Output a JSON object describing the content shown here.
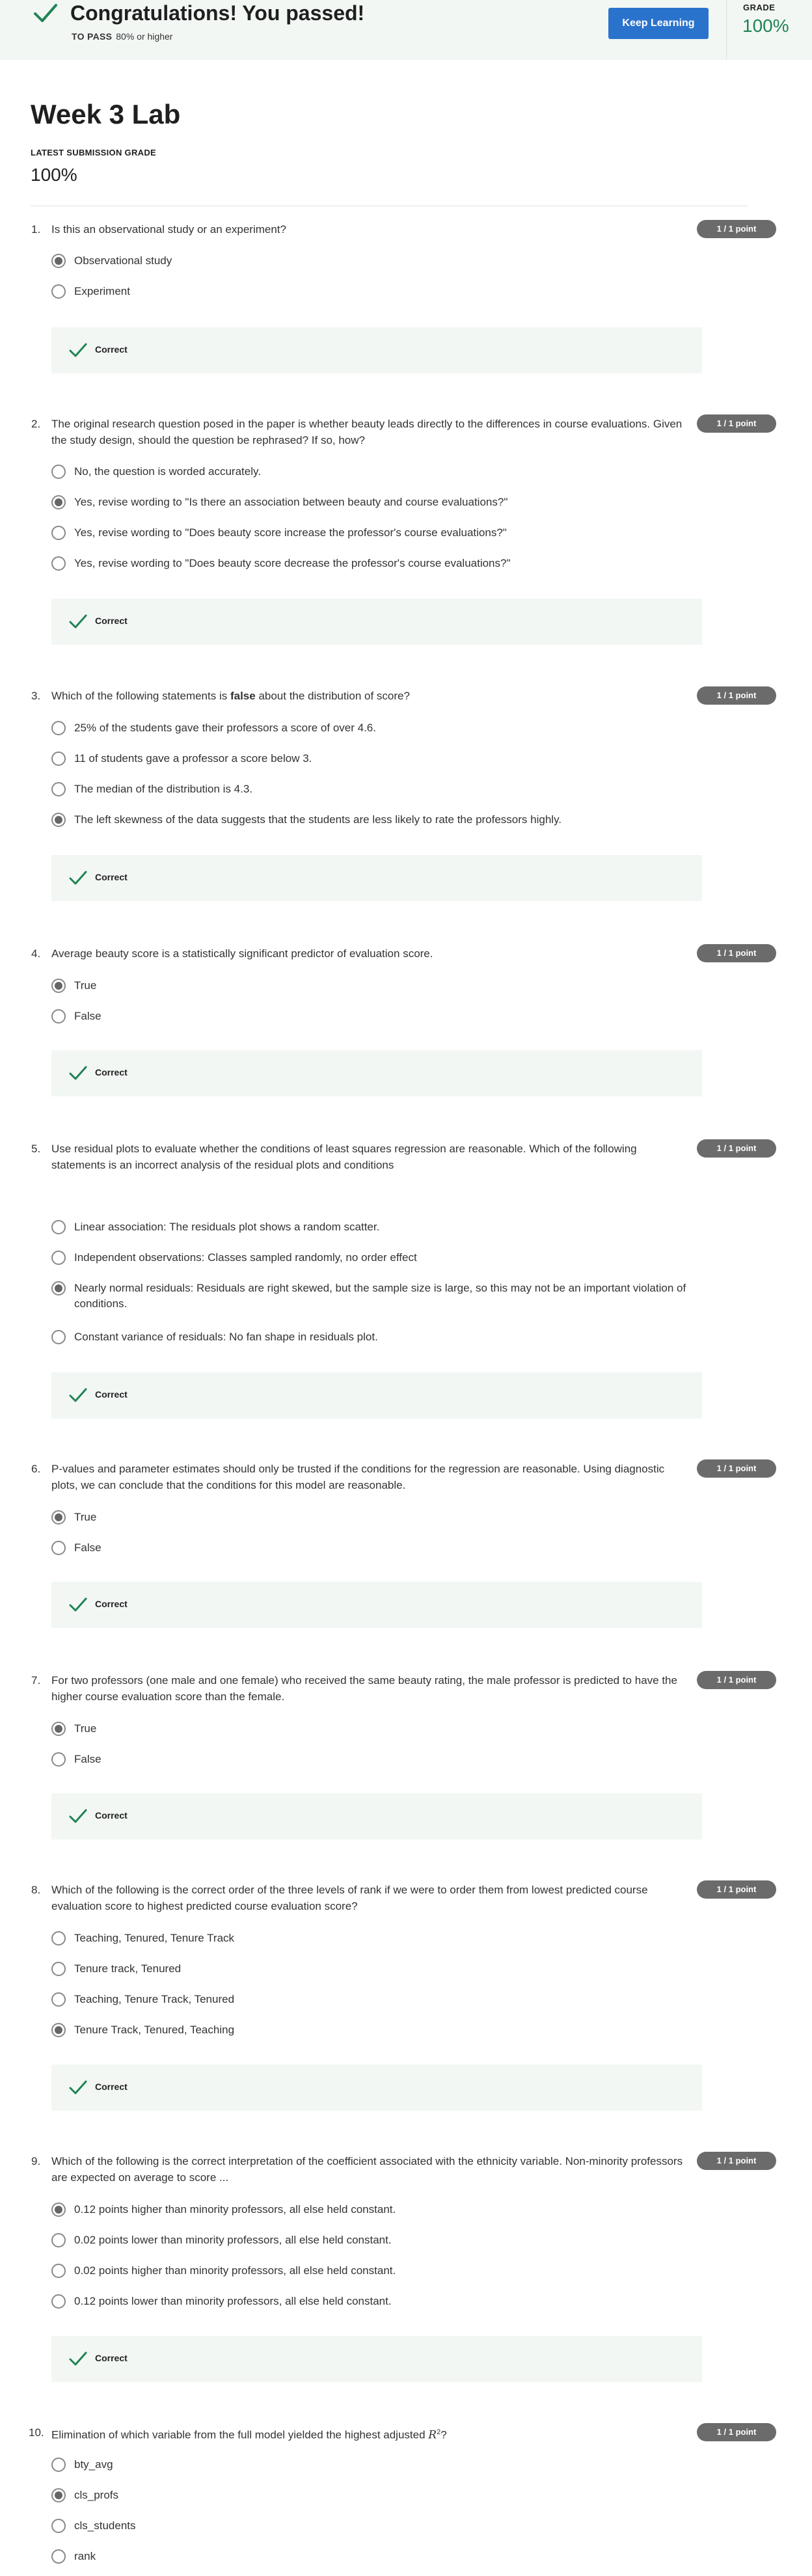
{
  "banner": {
    "title": "Congratulations! You passed!",
    "to_pass_label": "TO PASS",
    "to_pass_value": "80% or higher",
    "keep_learning": "Keep Learning",
    "grade_label": "GRADE",
    "grade_value": "100%"
  },
  "header": {
    "title": "Week 3 Lab",
    "latest_label": "LATEST SUBMISSION GRADE",
    "latest_value": "100%"
  },
  "feedback_label": "Correct",
  "points": "1 / 1 point",
  "questions": [
    {
      "num": "1.",
      "text": "Is this an observational study or an experiment?",
      "options": [
        "Observational study",
        "Experiment"
      ],
      "selected": 0
    },
    {
      "num": "2.",
      "text": "The original research question posed in the paper is whether beauty leads directly to the differences in course evaluations. Given the study design, should the question be rephrased? If so, how?",
      "options": [
        "No, the question is worded accurately.",
        "Yes, revise wording to \"Is there an association between beauty and course evaluations?\"",
        "Yes, revise wording to \"Does beauty score increase the professor's course evaluations?\"",
        "Yes, revise wording to \"Does beauty score decrease the professor's course evaluations?\""
      ],
      "selected": 1
    },
    {
      "num": "3.",
      "text_before": "Which of the following statements is ",
      "text_bold": "false",
      "text_after": " about the distribution of score?",
      "options": [
        "25% of the students gave their professors a score of over 4.6.",
        "11 of students gave a professor a score below 3.",
        "The median of the distribution is 4.3.",
        "The left skewness of the data suggests that the students are less likely to rate the professors highly."
      ],
      "selected": 3
    },
    {
      "num": "4.",
      "text": "Average beauty score is a statistically significant predictor of evaluation score.",
      "options": [
        "True",
        "False"
      ],
      "selected": 0
    },
    {
      "num": "5.",
      "text": "Use residual plots to evaluate whether the conditions of least squares regression are reasonable. Which of the following statements is an incorrect analysis of the residual plots and conditions",
      "options": [
        "Linear association: The residuals plot shows a random scatter.",
        "Independent observations: Classes sampled randomly, no order effect",
        "Nearly normal residuals: Residuals are right skewed, but the sample size is large, so this may not be an important violation of conditions.",
        "Constant variance of residuals: No fan shape in residuals plot."
      ],
      "selected": 2
    },
    {
      "num": "6.",
      "text": "P-values and parameter estimates should only be trusted if the conditions for the regression are reasonable. Using diagnostic plots, we can conclude that the conditions for this model are reasonable.",
      "options": [
        "True",
        "False"
      ],
      "selected": 0
    },
    {
      "num": "7.",
      "text": "For two professors (one male and one female) who received the same beauty rating, the male professor is predicted to have the higher course evaluation score than the female.",
      "options": [
        "True",
        "False"
      ],
      "selected": 0
    },
    {
      "num": "8.",
      "text": "Which of the following is the correct order of the three levels of rank if we were to order them from lowest predicted course evaluation score to highest predicted course evaluation score?",
      "options": [
        "Teaching, Tenured, Tenure Track",
        "Tenure track, Tenured",
        "Teaching, Tenure Track, Tenured",
        "Tenure Track, Tenured, Teaching"
      ],
      "selected": 3
    },
    {
      "num": "9.",
      "text": "Which of the following is the correct interpretation of the coefficient associated with the ethnicity variable. Non-minority professors are expected on average to score ...",
      "options": [
        "0.12 points higher than minority professors, all else held constant.",
        "0.02 points lower than minority professors, all else held constant.",
        "0.02 points higher than minority professors, all else held constant.",
        "0.12 points lower than minority professors, all else held constant."
      ],
      "selected": 0
    },
    {
      "num": "10.",
      "text_before": "Elimination of which variable from the full model yielded the highest adjusted ",
      "text_math": "R",
      "text_sup": "2",
      "text_after": "?",
      "options": [
        "bty_avg",
        "cls_profs",
        "cls_students",
        "rank"
      ],
      "selected": 1
    }
  ],
  "icons": {
    "banner_check": "check-icon",
    "feedback_check": "check-icon",
    "colors": {
      "accent_green": "#1f8354",
      "button_blue": "#2a73cc",
      "badge_gray": "#6b6b6b",
      "banner_bg": "#f2f7f4"
    }
  }
}
